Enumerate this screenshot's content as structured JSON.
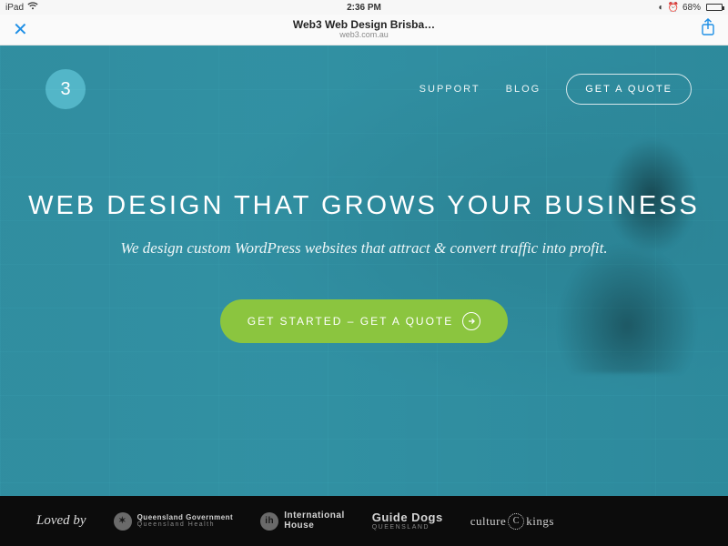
{
  "status": {
    "device": "iPad",
    "time": "2:36 PM",
    "battery_percent": "68%",
    "alarm": true,
    "dnd": true
  },
  "browser": {
    "title": "Web3 Web Design Brisba…",
    "url": "web3.com.au"
  },
  "nav": {
    "logo_text": "3",
    "support": "SUPPORT",
    "blog": "BLOG",
    "quote": "GET A QUOTE"
  },
  "hero": {
    "headline": "WEB DESIGN THAT GROWS YOUR BUSINESS",
    "subhead": "We design custom WordPress websites that attract & convert traffic into profit.",
    "cta": "GET STARTED – GET A QUOTE"
  },
  "loved": {
    "title": "Loved by",
    "clients": {
      "qld_top": "Queensland Government",
      "qld_bot": "Queensland Health",
      "ih_mark": "ih",
      "ih_top": "International",
      "ih_bot": "House",
      "gd_top": "Guide Dogs",
      "gd_bot": "QUEENSLAND",
      "ck_left": "culture",
      "ck_mark": "C",
      "ck_right": "kings"
    }
  }
}
